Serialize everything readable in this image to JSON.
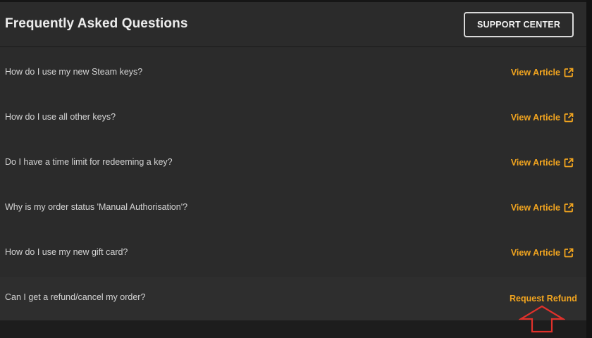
{
  "header": {
    "title": "Frequently Asked Questions",
    "support_button": "SUPPORT CENTER"
  },
  "faq": [
    {
      "question": "How do I use my new Steam keys?",
      "action": "View Article"
    },
    {
      "question": "How do I use all other keys?",
      "action": "View Article"
    },
    {
      "question": "Do I have a time limit for redeeming a key?",
      "action": "View Article"
    },
    {
      "question": "Why is my order status 'Manual Authorisation'?",
      "action": "View Article"
    },
    {
      "question": "How do I use my new gift card?",
      "action": "View Article"
    }
  ],
  "refund": {
    "question": "Can I get a refund/cancel my order?",
    "action": "Request Refund"
  },
  "colors": {
    "accent": "#f2a51f",
    "panel": "#2b2b2b",
    "annotation_arrow": "#e0312b"
  },
  "icons": {
    "view_article": "external-link-icon",
    "annotation": "up-arrow-annotation-icon"
  }
}
